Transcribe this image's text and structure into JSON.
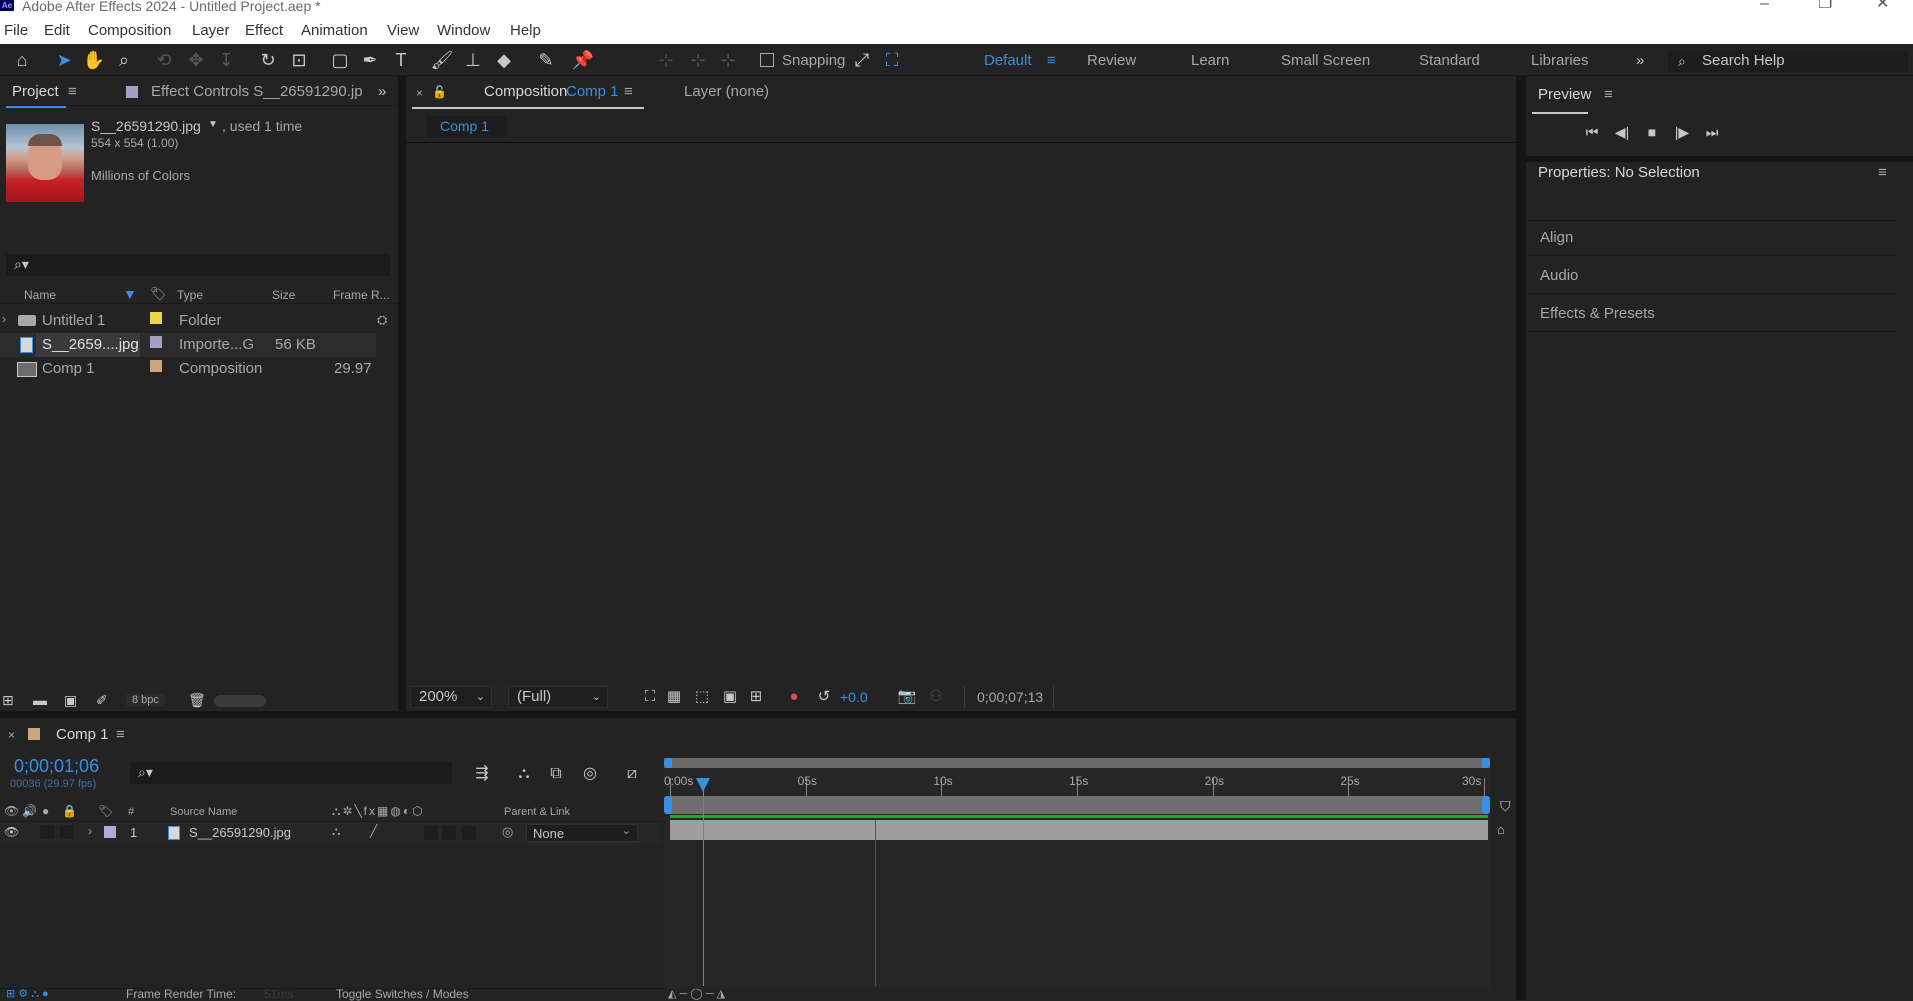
{
  "titlebar": {
    "title": "Adobe After Effects 2024 - Untitled Project.aep *",
    "logo": "Ae"
  },
  "menu": [
    "File",
    "Edit",
    "Composition",
    "Layer",
    "Effect",
    "Animation",
    "View",
    "Window",
    "Help"
  ],
  "toolbar": {
    "snapping_label": "Snapping",
    "workspaces": [
      "Default",
      "Review",
      "Learn",
      "Small Screen",
      "Standard",
      "Libraries"
    ],
    "search_placeholder": "Search Help"
  },
  "project": {
    "tab_label": "Project",
    "effect_controls_label": "Effect Controls S__26591290.jp",
    "file_name": "S__26591290.jpg",
    "used_text": ", used 1 time",
    "dimensions": "554 x 554 (1.00)",
    "colors": "Millions of Colors",
    "columns": {
      "name": "Name",
      "type": "Type",
      "size": "Size",
      "frame_rate": "Frame R..."
    },
    "items": [
      {
        "name": "Untitled 1",
        "type": "Folder",
        "size": "",
        "fps": "",
        "color": "#e8d84a"
      },
      {
        "name": "S__2659....jpg",
        "type": "Importe...G",
        "size": "56 KB",
        "fps": "",
        "color": "#a89ec8"
      },
      {
        "name": "Comp 1",
        "type": "Composition",
        "size": "",
        "fps": "29.97",
        "color": "#c8a67e"
      }
    ],
    "bpc": "8 bpc"
  },
  "composition": {
    "tab_prefix": "Composition",
    "tab_name": "Comp 1",
    "layer_tab": "Layer  (none)",
    "sub_tab": "Comp 1",
    "zoom": "200%",
    "resolution": "(Full)",
    "exposure": "+0.0",
    "timecode": "0;00;07;13"
  },
  "preview": {
    "title": "Preview"
  },
  "properties": {
    "title": "Properties: No Selection",
    "sections": [
      "Align",
      "Audio",
      "Effects & Presets"
    ]
  },
  "timeline": {
    "tab": "Comp 1",
    "timecode": "0;00;01;06",
    "frame_info": "00036 (29.97 fps)",
    "headers": {
      "num": "#",
      "source": "Source Name",
      "parent": "Parent & Link"
    },
    "ruler_labels": [
      "0:00s",
      "05s",
      "10s",
      "15s",
      "20s",
      "25s",
      "30s"
    ],
    "layer": {
      "index": "1",
      "name": "S__26591290.jpg",
      "parent": "None",
      "label_color": "#b4a8d8"
    },
    "footer": {
      "render_label": "Frame Render Time:",
      "render_value": "51ms",
      "toggle_label": "Toggle Switches / Modes"
    },
    "current_time_fraction": 0.04,
    "work_area_end_fraction": 1.0,
    "red_marker_fraction": 0.25
  },
  "colors": {
    "accent": "#3a8ee6",
    "panel": "#232323",
    "divider": "#151515",
    "layer_bar": "#9e9e9e",
    "green_bar": "#1fa83a",
    "red_marker": "#c22a2a"
  }
}
